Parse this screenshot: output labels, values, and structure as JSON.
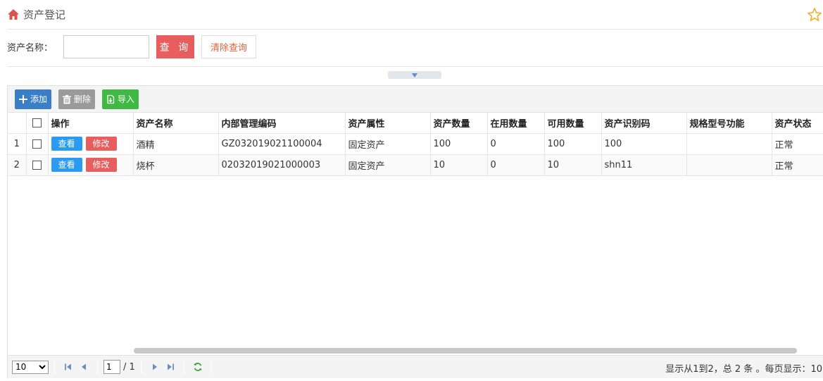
{
  "header": {
    "title": "资产登记",
    "home_icon": "home-icon",
    "star_icon": "star-icon"
  },
  "search": {
    "label": "资产名称：",
    "value": "",
    "placeholder": "",
    "query_label": "查 询",
    "clear_label": "清除查询"
  },
  "toolbar": {
    "add_label": "添加",
    "delete_label": "删除",
    "import_label": "导入"
  },
  "table": {
    "columns": [
      "操作",
      "资产名称",
      "内部管理编码",
      "资产属性",
      "资产数量",
      "在用数量",
      "可用数量",
      "资产识别码",
      "规格型号功能",
      "资产状态"
    ],
    "view_label": "查看",
    "edit_label": "修改",
    "rows": [
      {
        "num": "1",
        "name": "酒精",
        "code": "GZ032019021100004",
        "attr": "固定资产",
        "qty": "100",
        "in_use": "0",
        "available": "100",
        "ident": "100",
        "spec": "",
        "status": "正常"
      },
      {
        "num": "2",
        "name": "烧杯",
        "code": "02032019021000003",
        "attr": "固定资产",
        "qty": "10",
        "in_use": "0",
        "available": "10",
        "ident": "shn11",
        "spec": "",
        "status": "正常"
      }
    ]
  },
  "pager": {
    "page_size": "10",
    "page_size_options": [
      "10"
    ],
    "current_page": "1",
    "total_pages": "/ 1",
    "info": "显示从1到2，总 2 条 。每页显示：10"
  },
  "colors": {
    "accent_red": "#e85d5d",
    "accent_blue": "#2b9af3",
    "add_blue": "#3a7fc6",
    "import_green": "#3fb844"
  }
}
